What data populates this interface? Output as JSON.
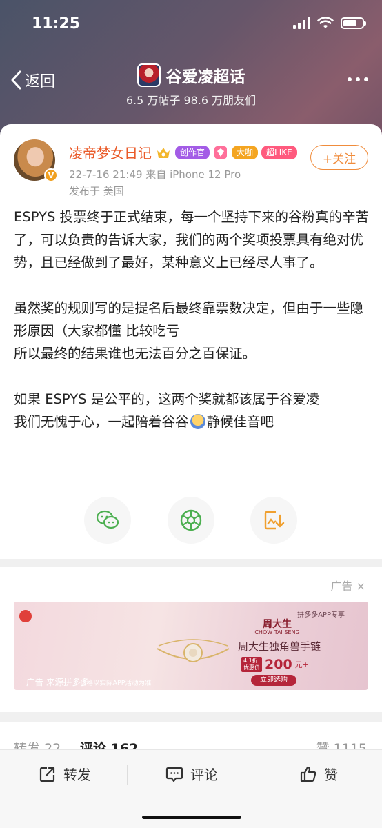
{
  "status_bar": {
    "time": "11:25"
  },
  "nav": {
    "back_label": "返回",
    "title": "谷爱凌超话",
    "subtitle": "6.5 万帖子  98.6 万朋友们"
  },
  "post": {
    "author": "凌帝梦女日记",
    "badges": {
      "creator": "创作官",
      "big": "大咖",
      "super": "超LIKE"
    },
    "follow_label": "+关注",
    "meta_time_source": "22-7-16 21:49  来自 iPhone 12 Pro",
    "meta_location": "发布于 美国",
    "paragraphs": [
      [
        "ESPYS 投票终于正式结束，每一个坚持下来的谷粉真的辛苦了，可以负责的告诉大家，我们的两个奖项投票具有绝对优势，且已经做到了最好，某种意义上已经尽人事了。"
      ],
      [
        "虽然奖的规则写的是提名后最终靠票数决定，但由于一些隐形原因（大家都懂 比较吃亏",
        "所以最终的结果谁也无法百分之百保证。"
      ],
      [
        "如果 ESPYS 是公平的，这两个奖就都该属于谷爱凌",
        "我们无愧于心，一起陪着谷谷",
        "静候佳音吧"
      ]
    ]
  },
  "share": [
    {
      "name": "wechat-share",
      "icon": "wechat-icon",
      "color": "#4caf50"
    },
    {
      "name": "moments-share",
      "icon": "moments-icon",
      "color": "#4caf50"
    },
    {
      "name": "save-image-share",
      "icon": "save-image-icon",
      "color": "#f0a030"
    }
  ],
  "ad": {
    "label": "广告",
    "close_icon": "×",
    "shop_tag": "拼多多APP专享",
    "brand": "周大生",
    "brand_en": "CHOW TAI SENG",
    "product": "周大生独角兽手链",
    "price_tag_line1": "4.1折",
    "price_tag_line2": "优惠价",
    "price": "200",
    "price_unit": "元+",
    "buy": "立即选购",
    "source": "广告 来源拼多多",
    "disclaimer": "价格以实际APP活动为准"
  },
  "stats": {
    "repost_label": "转发",
    "repost_count": "22",
    "comment_label": "评论",
    "comment_count": "162",
    "like_label": "赞",
    "like_count": "1115"
  },
  "bottom_bar": {
    "repost": "转发",
    "comment": "评论",
    "like": "赞"
  },
  "colors": {
    "accent": "#ea5b2a",
    "follow": "#f08c3c",
    "creator_badge": "#a35ce6",
    "big_badge": "#f4a521",
    "super_badge": "#ff5a7e"
  }
}
